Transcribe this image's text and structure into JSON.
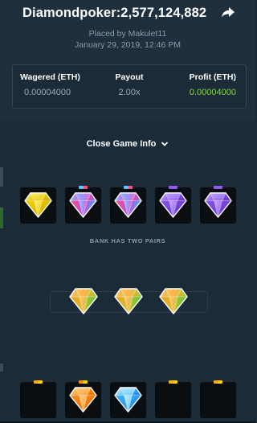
{
  "header": {
    "title": "Diamondpoker:2,577,124,882",
    "placed_by": "Placed by Makulet11",
    "date": "January 29, 2019, 12:46 PM"
  },
  "stats": {
    "wagered_label": "Wagered (ETH)",
    "wagered_value": "0.00004000",
    "payout_label": "Payout",
    "payout_value": "2.00x",
    "profit_label": "Profit (ETH)",
    "profit_value": "0.00004000"
  },
  "toggle": {
    "label": "Close Game Info"
  },
  "player_hand": {
    "gems": [
      "yellow",
      "pink-blue",
      "pink-blue",
      "purple",
      "purple"
    ]
  },
  "bank_result": "BANK HAS TWO PAIRS",
  "winning_gems": [
    "orange-green",
    "orange-green",
    "orange-green"
  ],
  "bank_hand": {
    "gems": [
      "none",
      "orange",
      "blue",
      "none",
      "none"
    ]
  },
  "colors": {
    "background": "#1b2b37",
    "header": "#1e303d",
    "profit_green": "#86d34a",
    "muted_text": "#8a9cab"
  }
}
